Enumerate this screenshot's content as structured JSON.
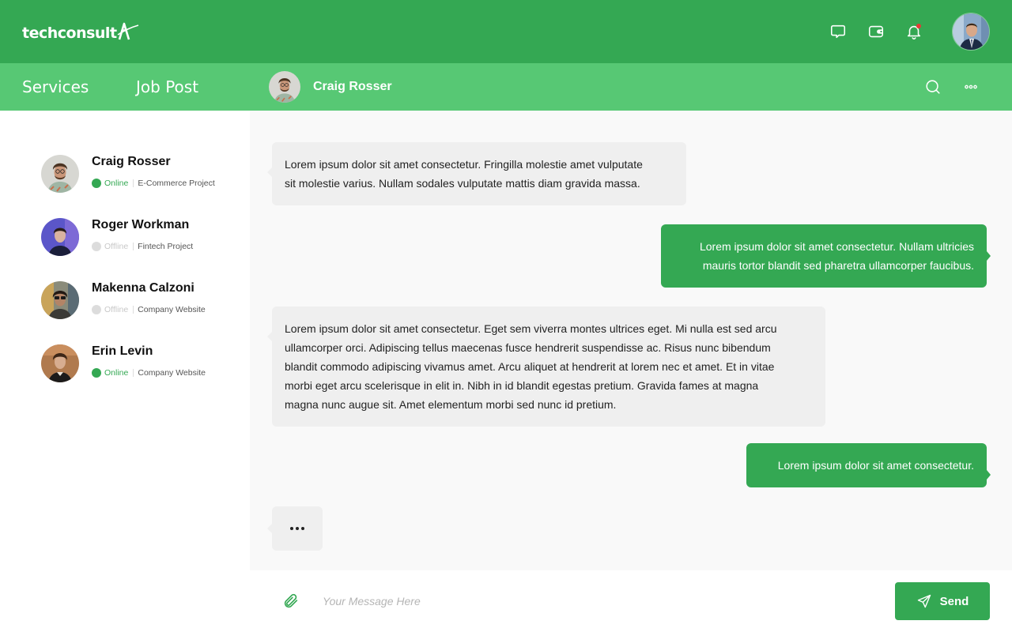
{
  "brand": {
    "name": "techconsult",
    "colors": {
      "primary": "#34a853",
      "secondary": "#57c874",
      "online": "#34a853",
      "offline": "#d9d9d9",
      "notification": "#e53935"
    }
  },
  "header": {
    "icons": [
      "chat-bubble-icon",
      "wallet-icon",
      "bell-icon"
    ],
    "profile_avatar": "profile-avatar"
  },
  "nav": {
    "items": [
      {
        "label": "Services"
      },
      {
        "label": "Job Post"
      }
    ]
  },
  "active_chat": {
    "name": "Craig Rosser",
    "icons": [
      "search-icon",
      "more-icon"
    ]
  },
  "contacts": [
    {
      "name": "Craig Rosser",
      "status": "Online",
      "project": "E-Commerce Project"
    },
    {
      "name": "Roger Workman",
      "status": "Offline",
      "project": "Fintech Project"
    },
    {
      "name": "Makenna Calzoni",
      "status": "Offline",
      "project": "Company Website"
    },
    {
      "name": "Erin Levin",
      "status": "Online",
      "project": "Company Website"
    }
  ],
  "messages": [
    {
      "direction": "in",
      "line1": "Lorem ipsum dolor sit amet consectetur. Fringilla molestie amet vulputate",
      "line2": "sit molestie varius. Nullam sodales vulputate mattis diam gravida massa."
    },
    {
      "direction": "out",
      "line1": "Lorem ipsum dolor sit amet consectetur. Nullam ultricies",
      "line2": "mauris tortor blandit sed pharetra ullamcorper faucibus."
    },
    {
      "direction": "in",
      "line1": "Lorem ipsum dolor sit amet consectetur. Eget sem viverra montes ultrices eget. Mi nulla est sed arcu",
      "line2": "ullamcorper orci. Adipiscing tellus maecenas fusce hendrerit suspendisse ac. Risus nunc bibendum",
      "line3": "blandit commodo adipiscing vivamus amet. Arcu aliquet at hendrerit at lorem nec et amet. Et in vitae",
      "line4": "morbi eget arcu scelerisque in elit in. Nibh in id blandit egestas pretium. Gravida fames at magna",
      "line5": "magna nunc augue sit. Amet elementum morbi sed nunc id pretium."
    },
    {
      "direction": "out",
      "line1": "Lorem ipsum dolor sit amet consectetur."
    }
  ],
  "composer": {
    "placeholder": "Your Message Here",
    "value": "",
    "send_label": "Send"
  }
}
